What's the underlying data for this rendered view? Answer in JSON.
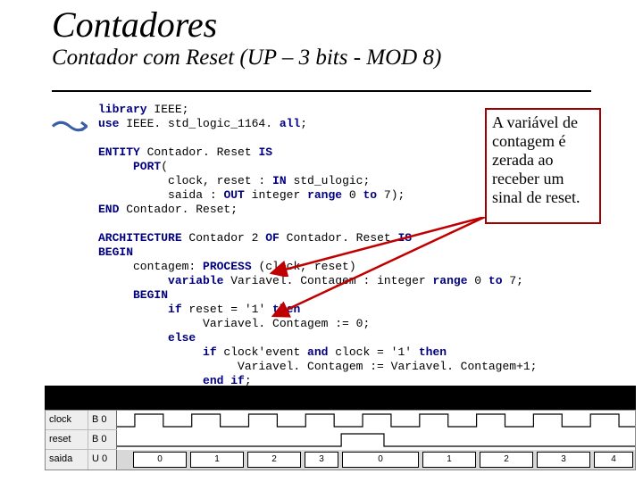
{
  "title": "Contadores",
  "subtitle": "Contador com Reset (UP – 3 bits - MOD 8)",
  "callout": "A variável de contagem é zerada ao receber um sinal de reset.",
  "code": {
    "l1a": "library",
    "l1b": " IEEE;",
    "l2a": "use",
    "l2b": " IEEE. std_logic_1164. ",
    "l2c": "all",
    "l2d": ";",
    "l4a": "ENTITY",
    "l4b": " Contador. Reset ",
    "l4c": "IS",
    "l5a": "     PORT",
    "l5b": "(",
    "l6a": "          clock, reset : ",
    "l6b": "IN",
    "l6c": " std_ulogic;",
    "l7a": "          saida : ",
    "l7b": "OUT",
    "l7c": " integer ",
    "l7d": "range",
    "l7e": " 0 ",
    "l7f": "to",
    "l7g": " 7);",
    "l8a": "END",
    "l8b": " Contador. Reset;",
    "l10a": "ARCHITECTURE",
    "l10b": " Contador 2 ",
    "l10c": "OF",
    "l10d": " Contador. Reset ",
    "l10e": "IS",
    "l11a": "BEGIN",
    "l12a": "     contagem: ",
    "l12b": "PROCESS",
    "l12c": " (clock, reset)",
    "l13a": "          variable",
    "l13b": " Variavel. Contagem : integer ",
    "l13c": "range",
    "l13d": " 0 ",
    "l13e": "to",
    "l13f": " 7;",
    "l14a": "     BEGIN",
    "l15a": "          if",
    "l15b": " reset = '1' ",
    "l15c": "then",
    "l16a": "               Variavel. Contagem := 0;",
    "l17a": "          else",
    "l18a": "               if",
    "l18b": " clock'event ",
    "l18c": "and",
    "l18d": " clock = '1' ",
    "l18e": "then",
    "l19a": "                    Variavel. Contagem := Variavel. Contagem+1;",
    "l20a": "               end if",
    "l20b": ";"
  },
  "wave": {
    "rows": [
      {
        "label": "clock",
        "state": "B 0"
      },
      {
        "label": "reset",
        "state": "B 0"
      },
      {
        "label": "saida",
        "state": "U 0"
      }
    ],
    "saida_values": [
      "0",
      "1",
      "2",
      "3",
      "0",
      "1",
      "2",
      "3",
      "4"
    ]
  }
}
